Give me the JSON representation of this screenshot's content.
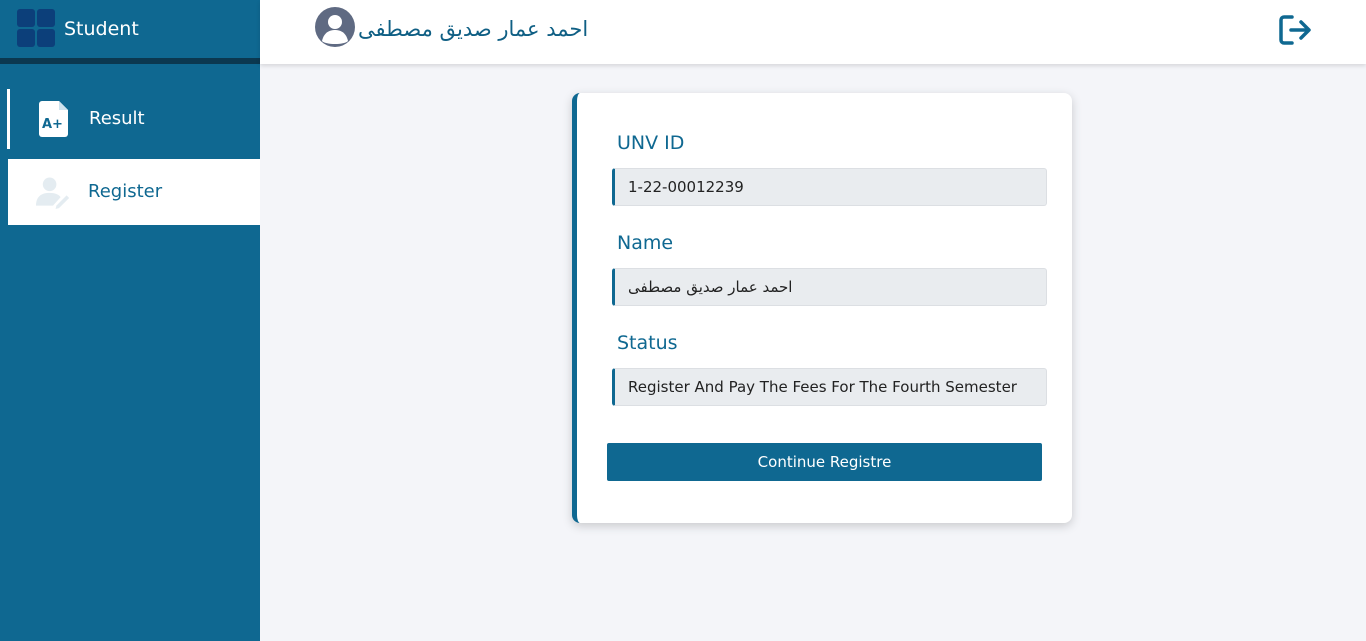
{
  "brand": {
    "title": "Student",
    "logo_icon": "dashboard-grid-icon"
  },
  "sidebar": {
    "items": [
      {
        "label": "Result",
        "icon": "grade-file-icon",
        "active": false
      },
      {
        "label": "Register",
        "icon": "user-edit-icon",
        "active": true
      }
    ]
  },
  "header": {
    "user_name": "احمد عمار صديق مصطفى",
    "avatar_icon": "user-avatar-icon",
    "logout_icon": "logout-icon"
  },
  "form": {
    "unv_id": {
      "label": "UNV ID",
      "value": "1-22-00012239"
    },
    "name": {
      "label": "Name",
      "value": "احمد عمار صديق مصطفى"
    },
    "status": {
      "label": "Status",
      "value": "Register And Pay The Fees For The Fourth Semester"
    },
    "continue_label": "Continue Registre"
  },
  "colors": {
    "primary": "#0f6891",
    "background": "#f4f5f9",
    "input_bg": "#e9ecef"
  }
}
